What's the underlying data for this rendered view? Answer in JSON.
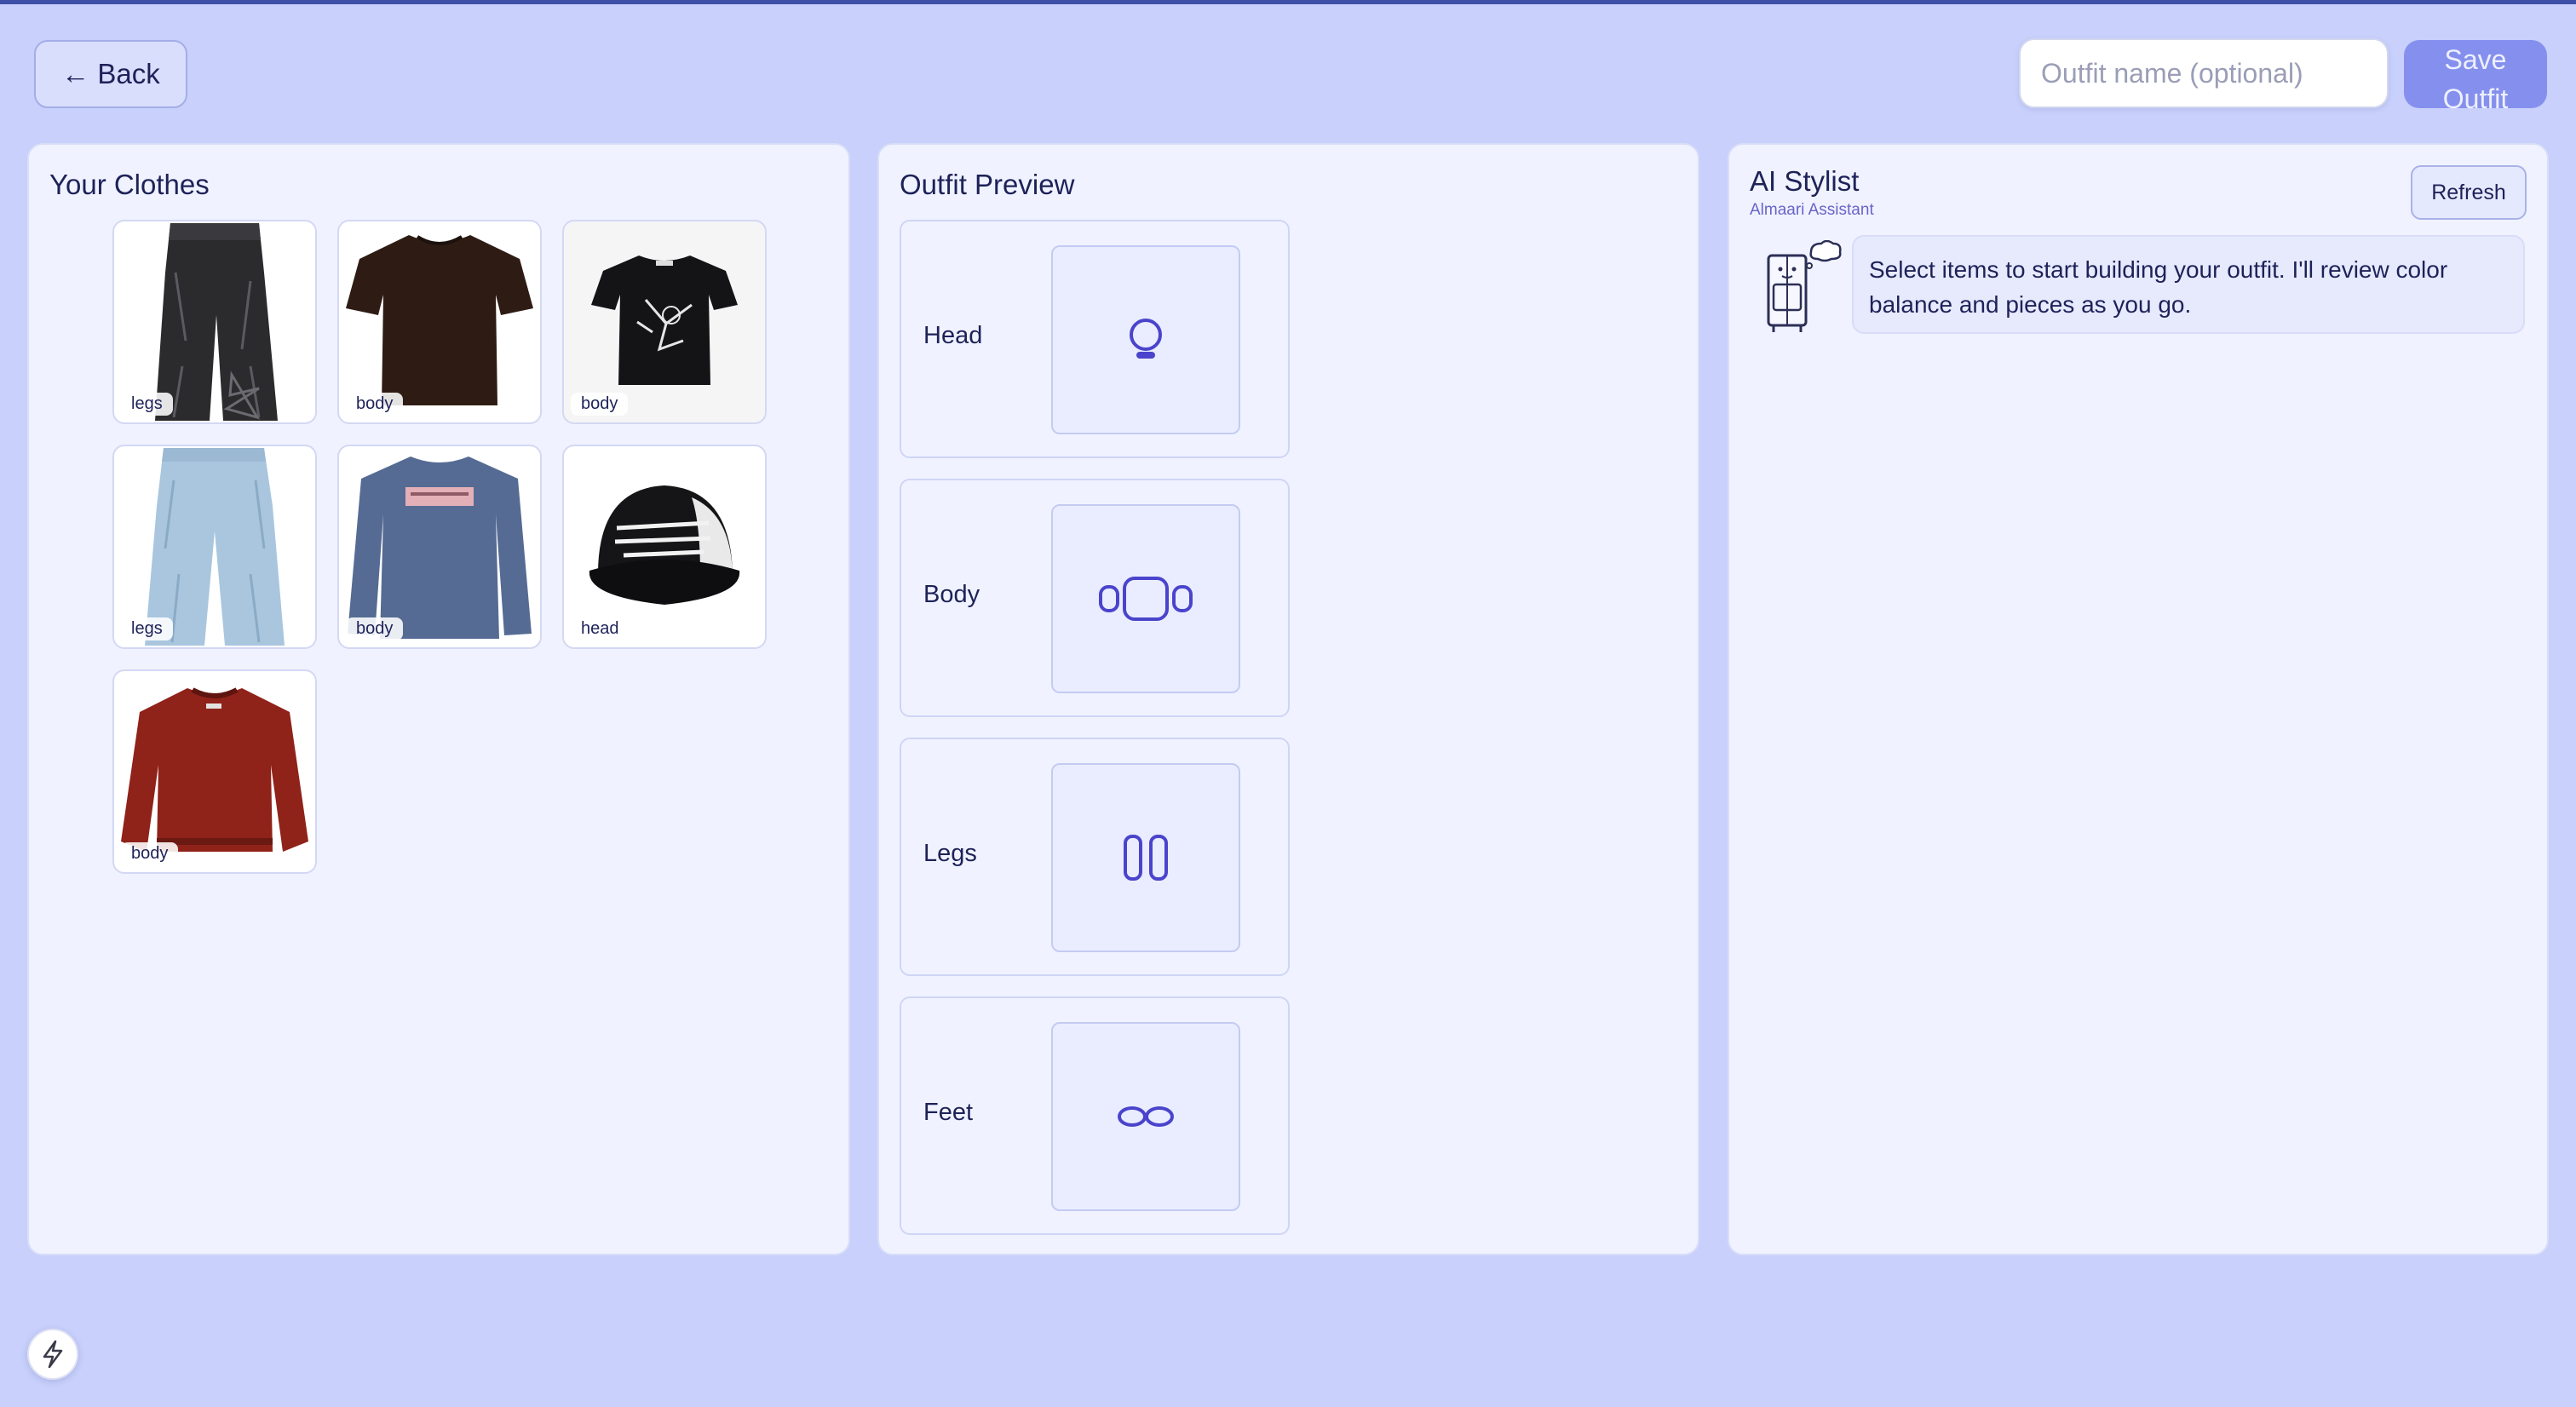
{
  "header": {
    "back_label": "← Back",
    "outfit_name_placeholder": "Outfit name (optional)",
    "outfit_name_value": "",
    "save_label": "Save Outfit"
  },
  "clothes": {
    "title": "Your Clothes",
    "items": [
      {
        "category": "legs",
        "description": "black distressed wide jeans"
      },
      {
        "category": "body",
        "description": "dark brown t-shirt"
      },
      {
        "category": "body",
        "description": "black graphic t-shirt"
      },
      {
        "category": "legs",
        "description": "light blue wide jeans"
      },
      {
        "category": "body",
        "description": "blue long sleeve tee"
      },
      {
        "category": "head",
        "description": "black trucker cap"
      },
      {
        "category": "body",
        "description": "red knit sweater"
      }
    ]
  },
  "preview": {
    "title": "Outfit Preview",
    "slots": [
      {
        "label": "Head",
        "icon": "head-icon"
      },
      {
        "label": "Body",
        "icon": "body-icon"
      },
      {
        "label": "Legs",
        "icon": "legs-icon"
      },
      {
        "label": "Feet",
        "icon": "feet-icon"
      }
    ]
  },
  "stylist": {
    "title": "AI Stylist",
    "subtitle": "Almaari Assistant",
    "refresh_label": "Refresh",
    "message": "Select items to start building your outfit. I'll review color balance and pieces as you go."
  },
  "colors": {
    "background": "#c8d0fb",
    "panel": "#f0f3ff",
    "accent": "#8590ee",
    "icon_stroke": "#4a44cc",
    "text": "#1e2258"
  }
}
